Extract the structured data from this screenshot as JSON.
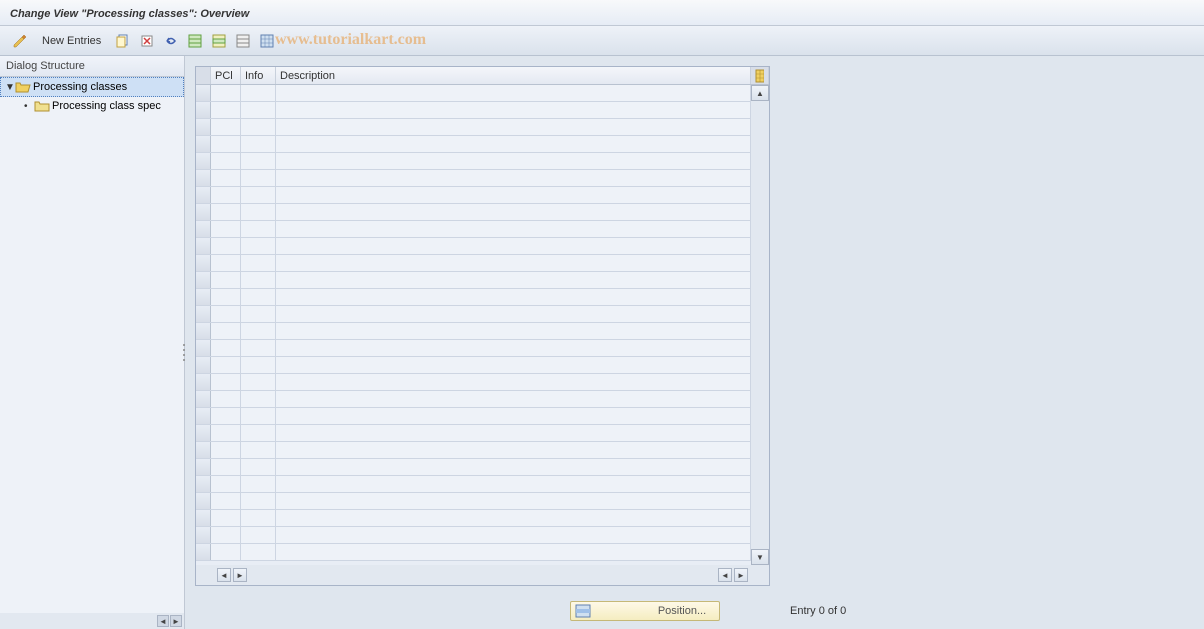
{
  "title": "Change View \"Processing classes\": Overview",
  "toolbar": {
    "new_entries": "New Entries"
  },
  "watermark": "www.tutorialkart.com",
  "sidebar": {
    "header": "Dialog Structure",
    "items": [
      {
        "label": "Processing classes",
        "selected": true,
        "open": true
      },
      {
        "label": "Processing class spec",
        "selected": false,
        "child": true
      }
    ]
  },
  "table": {
    "columns": {
      "pcl": "PCl",
      "info": "Info",
      "desc": "Description"
    },
    "rows": [
      {},
      {},
      {},
      {},
      {},
      {},
      {},
      {},
      {},
      {},
      {},
      {},
      {},
      {},
      {},
      {},
      {},
      {},
      {},
      {},
      {},
      {},
      {},
      {},
      {},
      {},
      {},
      {}
    ]
  },
  "footer": {
    "position_label": "Position...",
    "entry_text": "Entry 0 of 0"
  }
}
